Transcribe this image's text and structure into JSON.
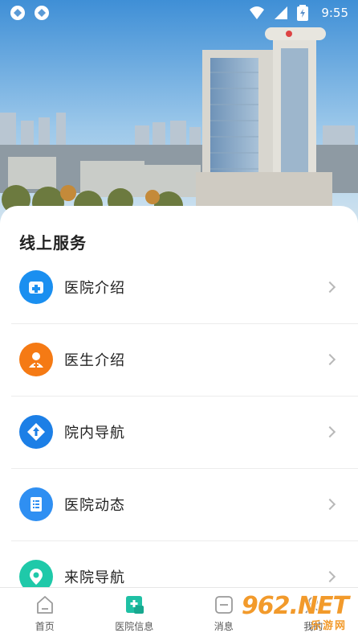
{
  "status_bar": {
    "time": "9:55",
    "left_icons": [
      "app-notification-icon",
      "app-notification-icon"
    ],
    "right_icons": [
      "wifi-icon",
      "signal-icon",
      "battery-charging-icon"
    ]
  },
  "hero": {
    "alt": "hospital-building-photo"
  },
  "section": {
    "title": "线上服务"
  },
  "services": [
    {
      "label": "医院介绍",
      "icon": "hospital-info-icon",
      "color": "#1a8ff0"
    },
    {
      "label": "医生介绍",
      "icon": "doctor-icon",
      "color": "#f57a14"
    },
    {
      "label": "院内导航",
      "icon": "navigation-diamond-icon",
      "color": "#1c7fe6"
    },
    {
      "label": "医院动态",
      "icon": "news-list-icon",
      "color": "#2f8ff2"
    },
    {
      "label": "来院导航",
      "icon": "location-pin-icon",
      "color": "#1fc9a9"
    }
  ],
  "tabbar": {
    "tabs": [
      {
        "label": "首页",
        "icon": "home-icon",
        "active": false
      },
      {
        "label": "医院信息",
        "icon": "hospital-plus-icon",
        "active": true
      },
      {
        "label": "消息",
        "icon": "message-icon",
        "active": false
      },
      {
        "label": "我的",
        "icon": "profile-icon",
        "active": false
      }
    ],
    "active_color": "#1fc0a4"
  },
  "watermark": {
    "text": "962.NET",
    "sub": "乐游网"
  }
}
